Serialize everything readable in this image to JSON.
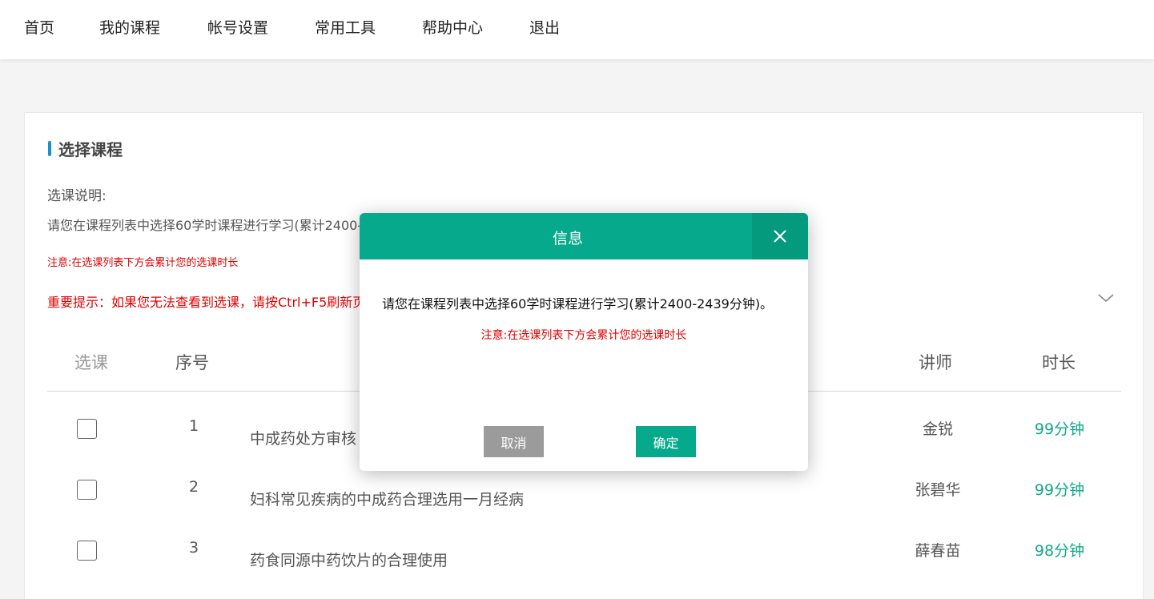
{
  "nav": {
    "items": [
      "首页",
      "我的课程",
      "帐号设置",
      "常用工具",
      "帮助中心",
      "退出"
    ]
  },
  "section": {
    "title": "选择课程",
    "desc_label": "选课说明:",
    "desc_text": "请您在课程列表中选择60学时课程进行学习(累计2400-2439分钟)。",
    "note": "注意:在选课列表下方会累计您的选课时长",
    "important": "重要提示：如果您无法查看到选课，请按Ctrl+F5刷新页面"
  },
  "table": {
    "headers": {
      "select": "选课",
      "index": "序号",
      "teacher": "讲师",
      "duration": "时长"
    },
    "rows": [
      {
        "index": "1",
        "name": "中成药处方审核",
        "teacher": "金锐",
        "duration": "99分钟"
      },
      {
        "index": "2",
        "name": "妇科常见疾病的中成药合理选用一月经病",
        "teacher": "张碧华",
        "duration": "99分钟"
      },
      {
        "index": "3",
        "name": "药食同源中药饮片的合理使用",
        "teacher": "薛春苗",
        "duration": "98分钟"
      }
    ]
  },
  "modal": {
    "title": "信息",
    "message": "请您在课程列表中选择60学时课程进行学习(累计2400-2439分钟)。",
    "note": "注意:在选课列表下方会累计您的选课时长",
    "cancel_label": "取消",
    "ok_label": "确定"
  },
  "colors": {
    "accent": "#06a98b",
    "warning": "#e00000",
    "section_marker": "#1a8fd0"
  },
  "icons": {
    "close": "close-icon",
    "expand": "chevron-down-icon"
  }
}
